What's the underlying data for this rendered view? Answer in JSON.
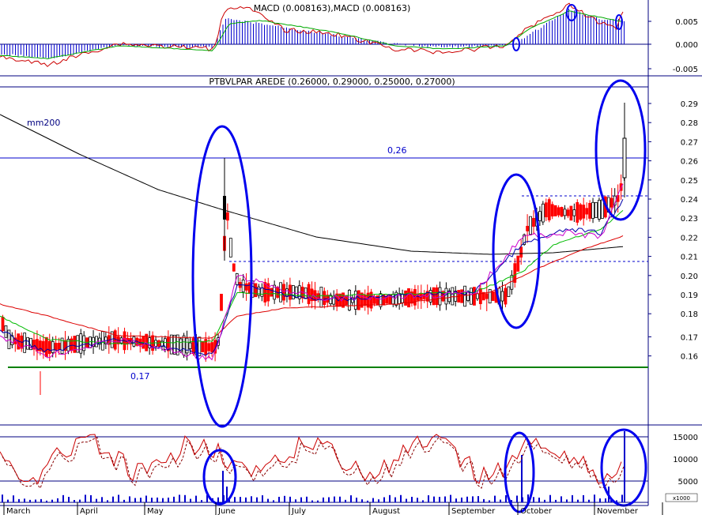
{
  "macd_panel": {
    "title": "MACD (0.008163),MACD (0.008163)",
    "yticks": [
      "0.005",
      "0.000",
      "-0.005"
    ]
  },
  "price_panel": {
    "title": "PTBVLPAR AREDE (0.26000, 0.29000, 0.25000, 0.27000)",
    "ma_label": "mm200",
    "resistance_label": "0,26",
    "support_label": "0,17",
    "yticks": [
      "0.29",
      "0.28",
      "0.27",
      "0.26",
      "0.25",
      "0.24",
      "0.23",
      "0.22",
      "0.21",
      "0.20",
      "0.19",
      "0.18",
      "0.17",
      "0.16"
    ]
  },
  "volume_panel": {
    "yticks": [
      "15000",
      "10000",
      "5000"
    ],
    "unit": "x1000"
  },
  "xaxis": {
    "months": [
      "March",
      "April",
      "May",
      "June",
      "July",
      "August",
      "September",
      "October",
      "November"
    ]
  },
  "colors": {
    "frame": "#000080",
    "macd_hist": "#0000cc",
    "line_red": "#cc0000",
    "line_green": "#00aa00",
    "ma200": "#000000",
    "circle": "#0000ee",
    "support": "#008000",
    "candle_up": "#000000",
    "candle_down": "#ff0000"
  },
  "chart_data": {
    "type": "candlestick",
    "title": "PTBVLPAR AREDE (0.26000, 0.29000, 0.25000, 0.27000)",
    "last_ohlc": {
      "open": 0.26,
      "high": 0.29,
      "low": 0.25,
      "close": 0.27
    },
    "ylim": [
      0.155,
      0.295
    ],
    "horizontal_levels": [
      0.26,
      0.24,
      0.21,
      0.17
    ],
    "monthly_closes": [
      {
        "month": "March",
        "close": 0.18
      },
      {
        "month": "April",
        "close": 0.18
      },
      {
        "month": "May",
        "close": 0.18
      },
      {
        "month": "June",
        "close": 0.2
      },
      {
        "month": "July",
        "close": 0.195
      },
      {
        "month": "August",
        "close": 0.195
      },
      {
        "month": "September",
        "close": 0.195
      },
      {
        "month": "October",
        "close": 0.23
      },
      {
        "month": "November",
        "close": 0.27
      }
    ],
    "macd_ylim": [
      -0.006,
      0.009
    ],
    "volume_ylim": [
      0,
      17000
    ]
  }
}
